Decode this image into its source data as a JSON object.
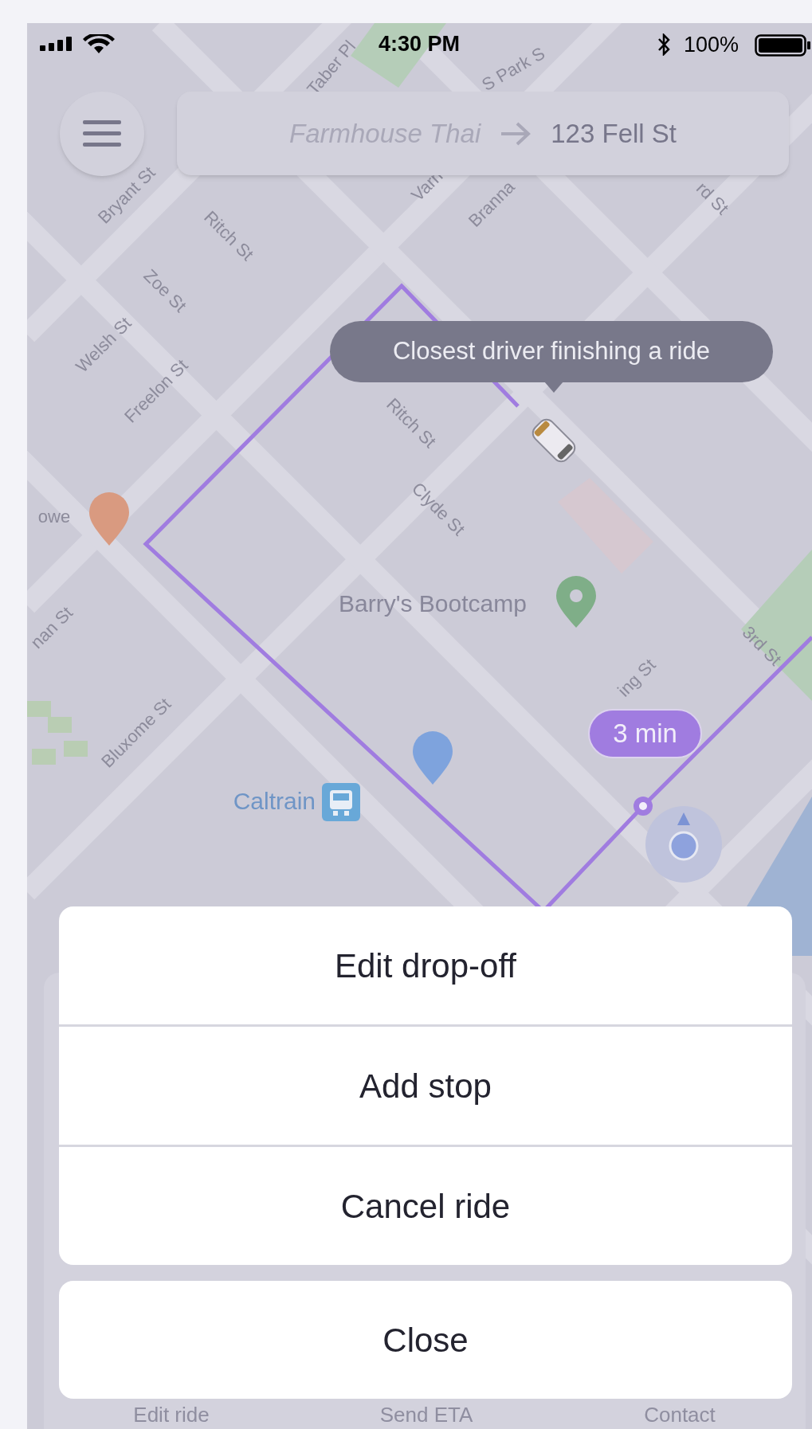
{
  "status_bar": {
    "time": "4:30 PM",
    "battery": "100%"
  },
  "route_bar": {
    "origin": "Farmhouse Thai",
    "destination": "123 Fell St"
  },
  "map": {
    "street_labels": [
      {
        "text": "Taber Pl"
      },
      {
        "text": "S Park S"
      },
      {
        "text": "Bryant St"
      },
      {
        "text": "Varn"
      },
      {
        "text": "Branna"
      },
      {
        "text": "rd St"
      },
      {
        "text": "Ritch St"
      },
      {
        "text": "Zoe St"
      },
      {
        "text": "Welsh St"
      },
      {
        "text": "Freelon St"
      },
      {
        "text": "Ritch St"
      },
      {
        "text": "Clyde St"
      },
      {
        "text": "owe"
      },
      {
        "text": "nan St"
      },
      {
        "text": "Bluxome St"
      },
      {
        "text": "ing St"
      },
      {
        "text": "3rd St"
      }
    ],
    "places": [
      {
        "text": "Barry's Bootcamp",
        "kind": "gym"
      },
      {
        "text": "Caltrain",
        "kind": "train"
      }
    ],
    "driver_tooltip": "Closest driver finishing a ride",
    "eta_badge": "3 min"
  },
  "bottom_bar": [
    "Edit ride",
    "Send ETA",
    "Contact"
  ],
  "action_sheet": {
    "actions": [
      "Edit drop-off",
      "Add stop",
      "Cancel ride"
    ],
    "close": "Close"
  }
}
